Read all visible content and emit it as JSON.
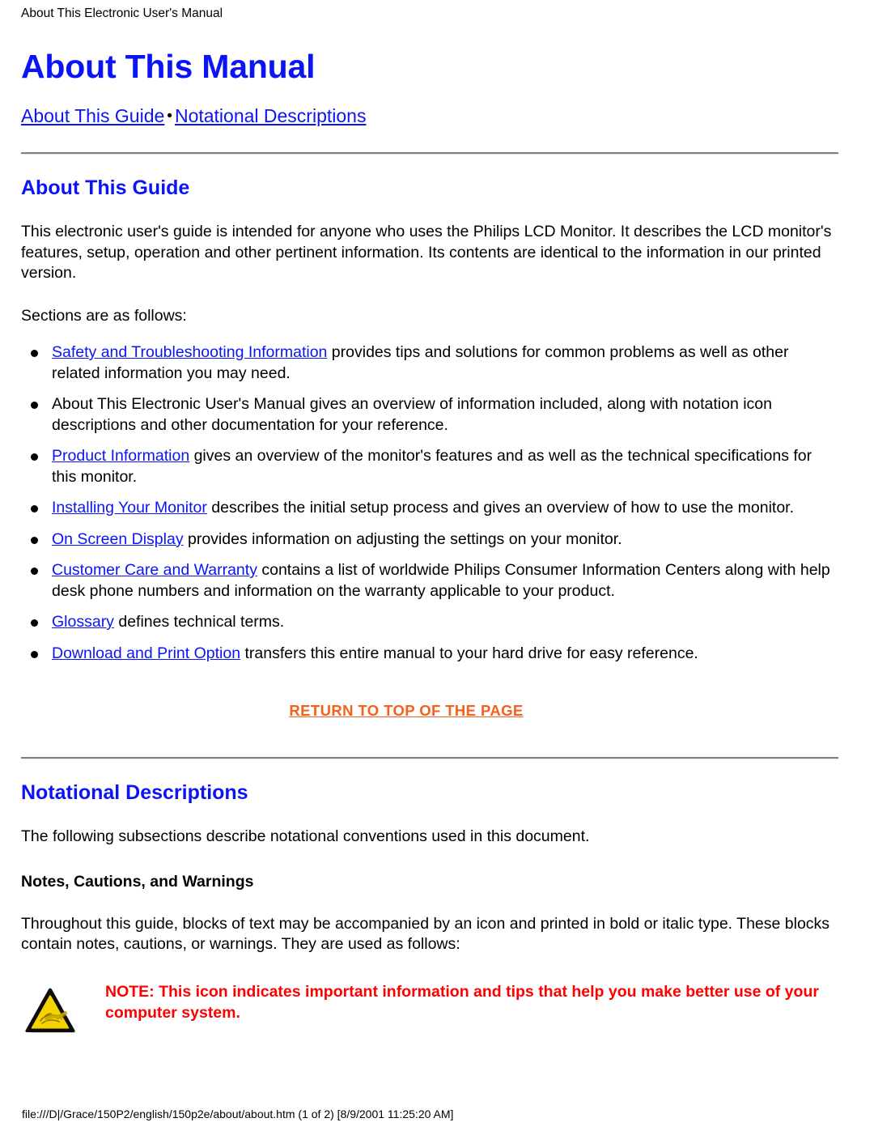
{
  "document": {
    "running_header": "About This Electronic User's Manual",
    "title": "About This Manual",
    "nav": {
      "link1": "About This Guide",
      "separator": "•",
      "link2": "Notational Descriptions"
    },
    "footer_path": "file:///D|/Grace/150P2/english/150p2e/about/about.htm (1 of 2) [8/9/2001 11:25:20 AM]"
  },
  "about_this_guide": {
    "heading": "About This Guide",
    "intro": "This electronic user's guide is intended for anyone who uses the Philips LCD Monitor. It describes the LCD monitor's features, setup, operation and other pertinent information. Its contents are identical to the information in our printed version.",
    "sections_lead": "Sections are as follows:",
    "items": [
      {
        "link": "Safety and Troubleshooting Information",
        "text": " provides tips and solutions for common problems as well as other related information you may need."
      },
      {
        "link": "",
        "text": "About This Electronic User's Manual gives an overview of information included, along with notation icon descriptions and other documentation for your reference."
      },
      {
        "link": "Product Information",
        "text": " gives an overview of the monitor's features and as well as the technical specifications for this monitor."
      },
      {
        "link": "Installing Your Monitor",
        "text": " describes the initial setup process and gives an overview of how to use the monitor."
      },
      {
        "link": "On Screen Display",
        "text": " provides information on adjusting the settings on your monitor."
      },
      {
        "link": "Customer Care and Warranty",
        "text": " contains a list of worldwide Philips Consumer Information Centers along with help desk phone numbers and information on the warranty applicable to your product."
      },
      {
        "link": "Glossary",
        "text": " defines technical terms."
      },
      {
        "link": "Download and Print Option",
        "text": " transfers this entire manual to your hard drive for easy reference."
      }
    ],
    "return_to_top": "RETURN TO TOP OF THE PAGE"
  },
  "notational_descriptions": {
    "heading": "Notational Descriptions",
    "intro": "The following subsections describe notational conventions used in this document.",
    "subheading": "Notes, Cautions, and Warnings",
    "body": "Throughout this guide, blocks of text may be accompanied by an icon and printed in bold or italic type. These blocks contain notes, cautions, or warnings. They are used as follows:",
    "note": {
      "icon": "note-warning-triangle-icon",
      "text": "NOTE: This icon indicates important information and tips that help you make better use of your computer system."
    }
  },
  "colors": {
    "heading_blue": "#0b15f4",
    "link_blue": "#0b15f4",
    "return_orange": "#f4611a",
    "note_red": "#ff0000",
    "rule_gray": "#808080",
    "icon_yellow": "#f5d300"
  }
}
